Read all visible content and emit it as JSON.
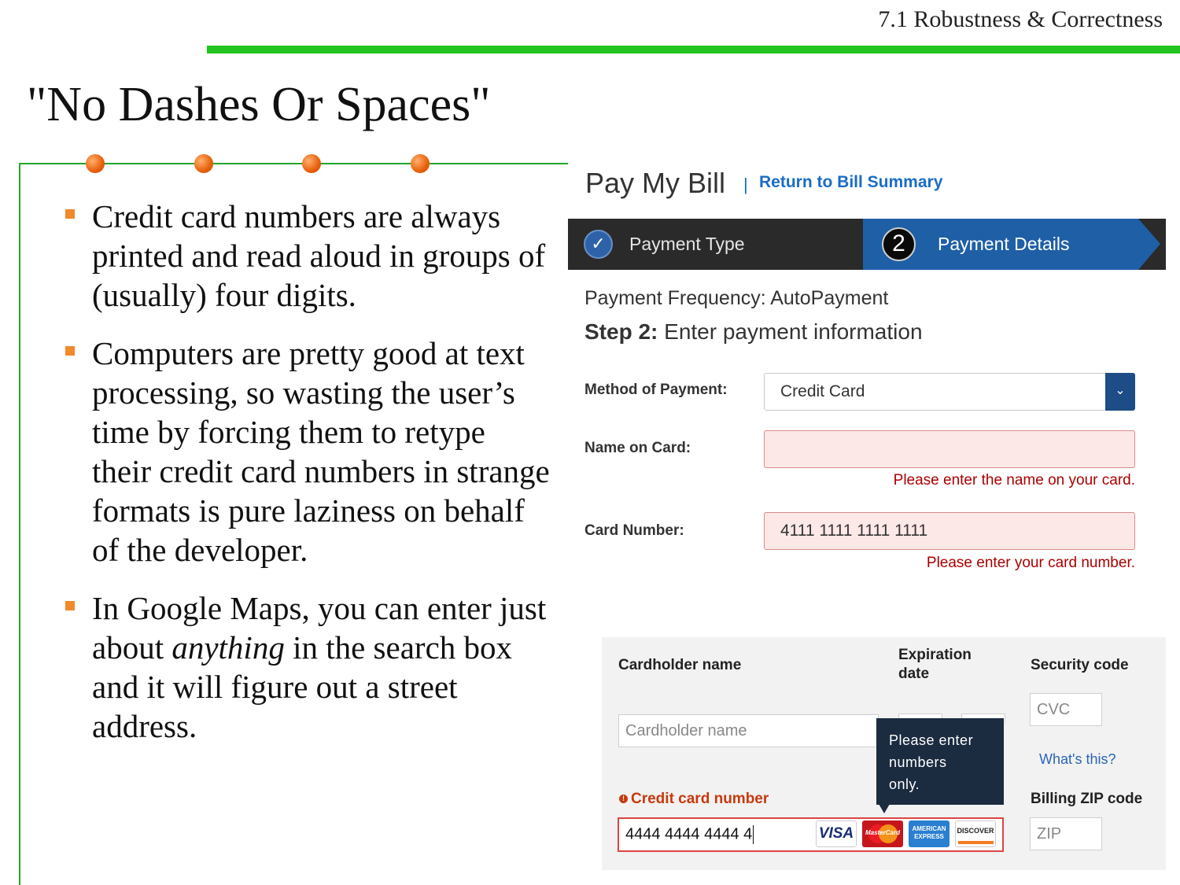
{
  "slide": {
    "section": "7.1 Robustness & Correctness",
    "title": "\"No Dashes Or Spaces\"",
    "bullets": [
      "Credit card numbers are always printed and read aloud in groups of (usually) four digits.",
      "Computers are pretty good at text processing, so wasting the user’s time by forcing them to retype their credit card numbers in strange formats is pure laziness on behalf of the developer."
    ],
    "bullet3": {
      "before": "In Google Maps, you can enter just about ",
      "emphasis": "anything",
      "after": " in the search box and it will figure out a street address."
    },
    "colors": {
      "accent_green": "#22c422",
      "bullet_orange": "#f08a2a"
    }
  },
  "pay_my_bill": {
    "title": "Pay My Bill",
    "separator": "|",
    "return_link": "Return to Bill Summary",
    "steps": [
      {
        "label": "Payment Type",
        "icon": "check-icon"
      },
      {
        "label": "Payment Details",
        "number": "2"
      }
    ],
    "frequency": "Payment Frequency: AutoPayment",
    "step_prefix": "Step 2:",
    "step_text": " Enter payment information",
    "method_label": "Method of Payment:",
    "method_value": "Credit Card",
    "name_label": "Name on Card:",
    "name_value": "",
    "name_error": "Please enter the name on your card.",
    "card_label": "Card Number:",
    "card_value": "4111 1111 1111 1111",
    "card_error": "Please enter your card number."
  },
  "checkout": {
    "cardholder_label": "Cardholder name",
    "cardholder_placeholder": "Cardholder name",
    "expiration_label_1": "Expiration",
    "expiration_label_2": "date",
    "security_label": "Security code",
    "cvc_placeholder": "CVC",
    "whats_this": "What's this?",
    "cc_label": "Credit card number",
    "cc_value": "4444 4444 4444 4",
    "tooltip_lines": [
      "Please enter",
      "numbers",
      "only."
    ],
    "zip_label": "Billing ZIP code",
    "zip_placeholder": "ZIP",
    "card_logos": {
      "visa": "VISA",
      "mastercard": "MasterCard",
      "amex_1": "AMERICAN",
      "amex_2": "EXPRESS",
      "discover": "DISCOVER"
    }
  }
}
